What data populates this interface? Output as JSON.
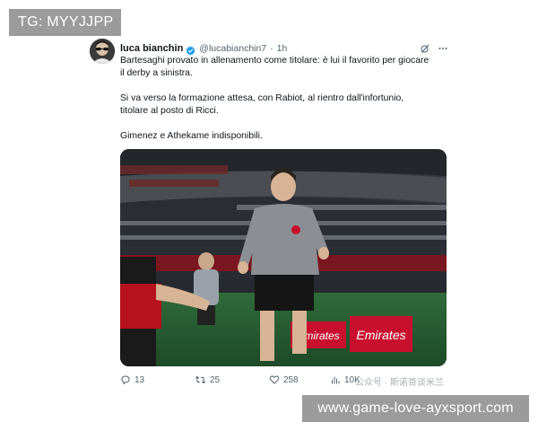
{
  "overlays": {
    "top_left_label": "TG: MYYJJPP",
    "bottom_right_label": "www.game-love-ayxsport.com"
  },
  "tweet": {
    "display_name": "luca bianchin",
    "handle": "@lucabianchin7",
    "separator": "·",
    "time": "1h",
    "paragraphs": [
      "Bartesaghi provato in allenamento come titolare: è lui il favorito per giocare\nil derby a sinistra.",
      "Si va verso la formazione attesa, con Rabiot, al rientro dall'infortunio,\ntitolare al posto di Ricci.",
      "Gimenez e Athekame indisponibili."
    ],
    "media": {
      "board_left": "Emirates",
      "board_right": "Emirates"
    },
    "stats": {
      "replies": "13",
      "reposts": "25",
      "likes": "258",
      "views": "10K"
    },
    "watermark": "公众号 · 斯诺哥谈米兰"
  },
  "colors": {
    "accent": "#1d9bf0",
    "muted_text": "#536471",
    "overlay_bg": "#9b9b9b",
    "milan_red": "#c8102e"
  },
  "icons": [
    "verified-badge-icon",
    "grok-icon",
    "more-icon",
    "reply-icon",
    "repost-icon",
    "like-icon",
    "views-icon"
  ]
}
